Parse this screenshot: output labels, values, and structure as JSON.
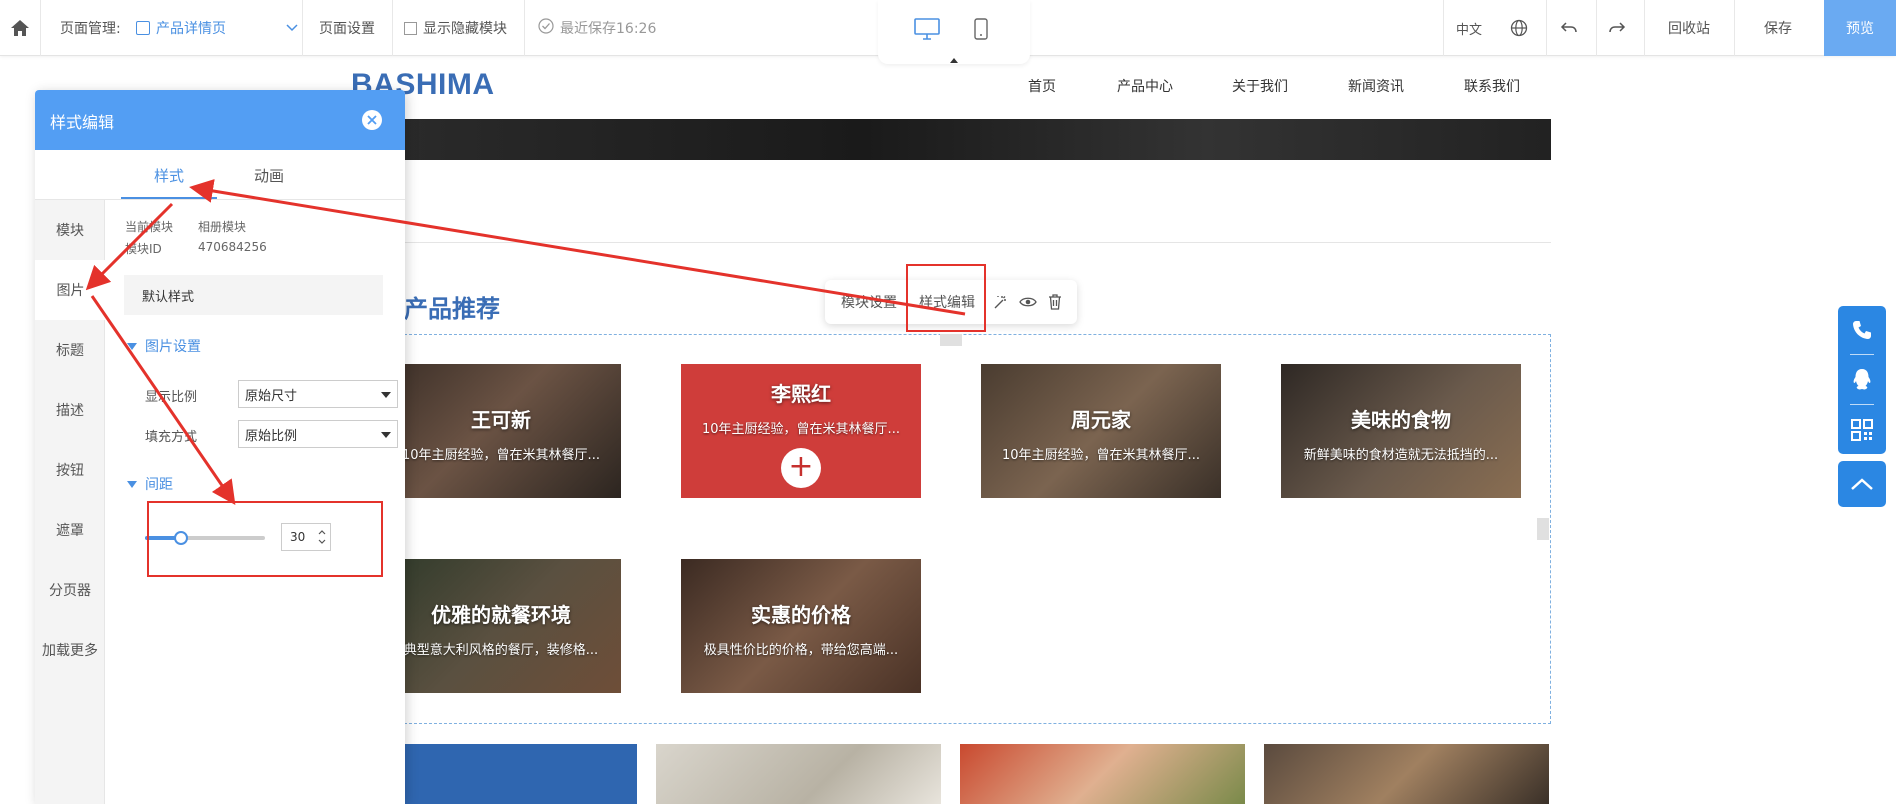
{
  "topbar": {
    "page_manage_label": "页面管理:",
    "current_page": "产品详情页",
    "page_settings": "页面设置",
    "show_hidden": "显示隐藏模块",
    "last_saved": "最近保存16:26",
    "language": "中文",
    "recycle": "回收站",
    "save": "保存",
    "preview": "预览"
  },
  "site": {
    "logo": "BASHIMA",
    "nav": [
      "首页",
      "产品中心",
      "关于我们",
      "新闻资讯",
      "联系我们"
    ],
    "section_title": "产品推荐"
  },
  "module_toolbar": {
    "settings": "模块设置",
    "style_edit": "样式编辑"
  },
  "cards": [
    {
      "title": "王可新",
      "desc": "10年主厨经验，曾在米其林餐厅..."
    },
    {
      "title": "李熙红",
      "desc": "10年主厨经验，曾在米其林餐厅..."
    },
    {
      "title": "周元家",
      "desc": "10年主厨经验，曾在米其林餐厅..."
    },
    {
      "title": "美味的食物",
      "desc": "新鲜美味的食材造就无法抵挡的..."
    },
    {
      "title": "优雅的就餐环境",
      "desc": "典型意大利风格的餐厅，装修格..."
    },
    {
      "title": "实惠的价格",
      "desc": "极具性价比的价格，带给您高端..."
    }
  ],
  "panel": {
    "title": "样式编辑",
    "tabs": [
      "样式",
      "动画"
    ],
    "side_items": [
      "模块",
      "图片",
      "标题",
      "描述",
      "按钮",
      "遮罩",
      "分页器",
      "加载更多"
    ],
    "current_module_label": "当前模块",
    "current_module_value": "相册模块",
    "module_id_label": "模块ID",
    "module_id_value": "470684256",
    "preset": "默认样式",
    "image_settings": "图片设置",
    "ratio_label": "显示比例",
    "ratio_value": "原始尺寸",
    "fill_label": "填充方式",
    "fill_value": "原始比例",
    "spacing_section": "间距",
    "spacing_value": "30",
    "spacing_fraction": 0.3
  },
  "colors": {
    "accent": "#539ef3",
    "brand": "#3a6db5",
    "annotation": "#e4322b",
    "service_bar": "#2b87e3"
  }
}
